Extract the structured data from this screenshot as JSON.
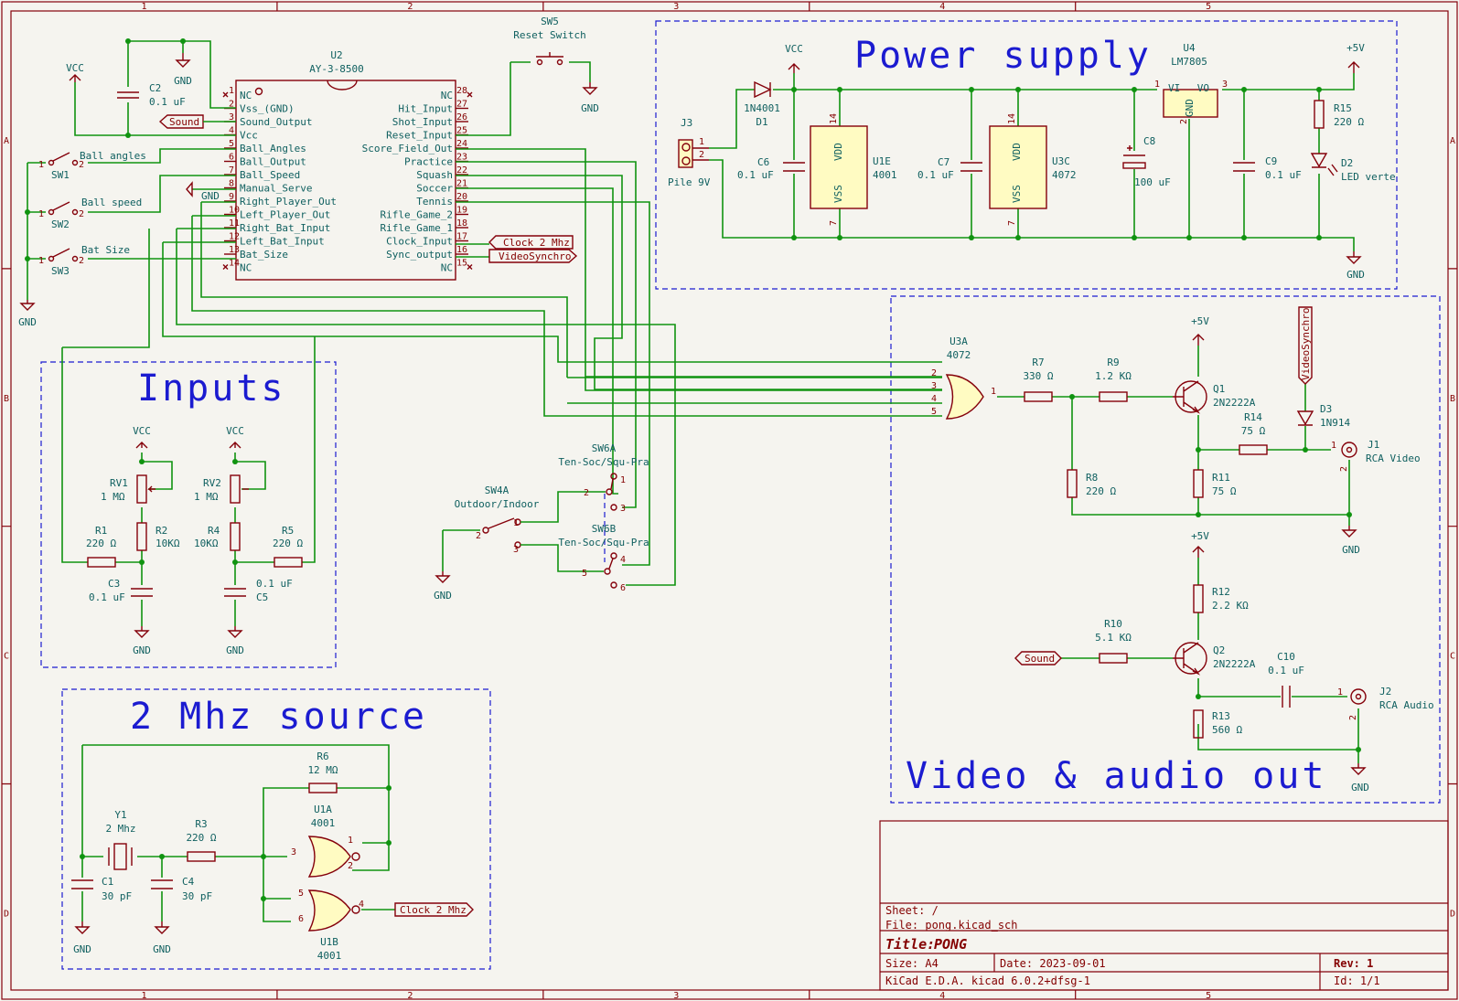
{
  "border": {
    "cols": [
      "1",
      "2",
      "3",
      "4",
      "5"
    ],
    "rows": [
      "A",
      "B",
      "C",
      "D"
    ]
  },
  "sections": {
    "power_supply": "Power supply",
    "inputs": "Inputs",
    "source": "2 Mhz source",
    "video_audio": "Video & audio out"
  },
  "title_block": {
    "sheet": "Sheet: /",
    "file": "File: pong.kicad_sch",
    "title_label": "Title:",
    "title": "PONG",
    "size": "Size: A4",
    "date": "Date: 2023-09-01",
    "rev": "Rev: 1",
    "tool": "KiCad E.D.A.  kicad 6.0.2+dfsg-1",
    "id": "Id: 1/1"
  },
  "power_flags": {
    "vcc": "VCC",
    "gnd": "GND",
    "plus5v": "+5V"
  },
  "u2": {
    "ref": "U2",
    "value": "AY-3-8500",
    "left_pins": [
      {
        "num": "1",
        "name": "NC"
      },
      {
        "num": "2",
        "name": "Vss_(GND)"
      },
      {
        "num": "3",
        "name": "Sound_Output"
      },
      {
        "num": "4",
        "name": "Vcc"
      },
      {
        "num": "5",
        "name": "Ball_Angles"
      },
      {
        "num": "6",
        "name": "Ball_Output"
      },
      {
        "num": "7",
        "name": "Ball_Speed"
      },
      {
        "num": "8",
        "name": "Manual_Serve"
      },
      {
        "num": "9",
        "name": "Right_Player_Out"
      },
      {
        "num": "10",
        "name": "Left_Player_Out"
      },
      {
        "num": "11",
        "name": "Right_Bat_Input"
      },
      {
        "num": "12",
        "name": "Left_Bat_Input"
      },
      {
        "num": "13",
        "name": "Bat_Size"
      },
      {
        "num": "14",
        "name": "NC"
      }
    ],
    "right_pins": [
      {
        "num": "28",
        "name": "NC"
      },
      {
        "num": "27",
        "name": "Hit_Input"
      },
      {
        "num": "26",
        "name": "Shot_Input"
      },
      {
        "num": "25",
        "name": "Reset_Input"
      },
      {
        "num": "24",
        "name": "Score_Field_Out"
      },
      {
        "num": "23",
        "name": "Practice"
      },
      {
        "num": "22",
        "name": "Squash"
      },
      {
        "num": "21",
        "name": "Soccer"
      },
      {
        "num": "20",
        "name": "Tennis"
      },
      {
        "num": "19",
        "name": "Rifle_Game_2"
      },
      {
        "num": "18",
        "name": "Rifle_Game_1"
      },
      {
        "num": "17",
        "name": "Clock_Input"
      },
      {
        "num": "16",
        "name": "Sync_output"
      },
      {
        "num": "15",
        "name": "NC"
      }
    ]
  },
  "labels": {
    "sound": "Sound",
    "clock": "Clock 2 Mhz",
    "videosync": "VideoSynchro"
  },
  "components": {
    "c2": {
      "ref": "C2",
      "value": "0.1 uF"
    },
    "sw5": {
      "ref": "SW5",
      "value": "Reset Switch"
    },
    "sw1": {
      "ref": "SW1",
      "value": "Ball angles"
    },
    "sw2": {
      "ref": "SW2",
      "value": "Ball speed"
    },
    "sw3": {
      "ref": "SW3",
      "value": "Bat Size"
    },
    "j3": {
      "ref": "J3",
      "value": "Pile 9V"
    },
    "d1": {
      "ref": "D1",
      "value": "1N4001"
    },
    "c6": {
      "ref": "C6",
      "value": "0.1 uF"
    },
    "u1e": {
      "ref": "U1E",
      "value": "4001"
    },
    "c7": {
      "ref": "C7",
      "value": "0.1 uF"
    },
    "u3c": {
      "ref": "U3C",
      "value": "4072"
    },
    "c8": {
      "ref": "C8",
      "value": "100 uF"
    },
    "u4": {
      "ref": "U4",
      "value": "LM7805"
    },
    "c9": {
      "ref": "C9",
      "value": "0.1 uF"
    },
    "r15": {
      "ref": "R15",
      "value": "220 Ω"
    },
    "d2": {
      "ref": "D2",
      "value": "LED verte"
    },
    "rv1": {
      "ref": "RV1",
      "value": "1 MΩ"
    },
    "rv2": {
      "ref": "RV2",
      "value": "1 MΩ"
    },
    "r1": {
      "ref": "R1",
      "value": "220 Ω"
    },
    "r2": {
      "ref": "R2",
      "value": "10KΩ"
    },
    "r4": {
      "ref": "R4",
      "value": "10KΩ"
    },
    "r5": {
      "ref": "R5",
      "value": "220 Ω"
    },
    "c3": {
      "ref": "C3",
      "value": "0.1 uF"
    },
    "c5": {
      "ref": "C5",
      "value": "0.1 uF"
    },
    "sw4a": {
      "ref": "SW4A",
      "value": "Outdoor/Indoor"
    },
    "sw6a": {
      "ref": "SW6A",
      "value": "Ten-Soc/Squ-Pra"
    },
    "sw6b": {
      "ref": "SW6B",
      "value": "Ten-Soc/Squ-Pra"
    },
    "u3a": {
      "ref": "U3A",
      "value": "4072"
    },
    "r7": {
      "ref": "R7",
      "value": "330 Ω"
    },
    "r9": {
      "ref": "R9",
      "value": "1.2 KΩ"
    },
    "q1": {
      "ref": "Q1",
      "value": "2N2222A"
    },
    "r8": {
      "ref": "R8",
      "value": "220 Ω"
    },
    "r11": {
      "ref": "R11",
      "value": "75 Ω"
    },
    "r14": {
      "ref": "R14",
      "value": "75 Ω"
    },
    "d3": {
      "ref": "D3",
      "value": "1N914"
    },
    "j1": {
      "ref": "J1",
      "value": "RCA Video"
    },
    "r12": {
      "ref": "R12",
      "value": "2.2 KΩ"
    },
    "r10": {
      "ref": "R10",
      "value": "5.1 KΩ"
    },
    "q2": {
      "ref": "Q2",
      "value": "2N2222A"
    },
    "c10": {
      "ref": "C10",
      "value": "0.1 uF"
    },
    "j2": {
      "ref": "J2",
      "value": "RCA Audio"
    },
    "r13": {
      "ref": "R13",
      "value": "560 Ω"
    },
    "r6": {
      "ref": "R6",
      "value": "12 MΩ"
    },
    "u1a": {
      "ref": "U1A",
      "value": "4001"
    },
    "y1": {
      "ref": "Y1",
      "value": "2 Mhz"
    },
    "r3": {
      "ref": "R3",
      "value": "220 Ω"
    },
    "c1": {
      "ref": "C1",
      "value": "30 pF"
    },
    "c4": {
      "ref": "C4",
      "value": "30 pF"
    },
    "u1b": {
      "ref": "U1B",
      "value": "4001"
    }
  },
  "pins": {
    "vdd": "VDD",
    "vss": "VSS",
    "vi": "VI",
    "vo": "VO",
    "gndpin": "GND",
    "n14": "14",
    "n7": "7",
    "n1": "1",
    "n2": "2",
    "n3": "3",
    "n4": "4",
    "n5": "5",
    "n6": "6"
  }
}
